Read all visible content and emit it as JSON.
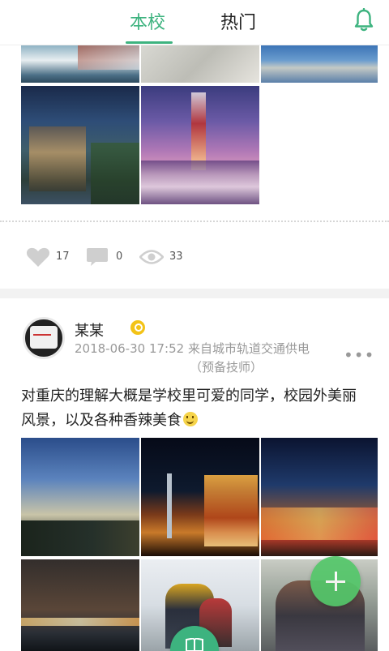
{
  "header": {
    "tabs": [
      {
        "label": "本校",
        "active": true
      },
      {
        "label": "热门",
        "active": false
      }
    ],
    "notification_icon": "bell-icon",
    "accent_color": "#3db37f"
  },
  "post1": {
    "image_count_visible": 5,
    "stats": {
      "likes": "17",
      "comments": "0",
      "views": "33"
    },
    "icons": [
      "heart-icon",
      "comment-icon",
      "eye-icon"
    ]
  },
  "post2": {
    "username": "某某",
    "badge_icon": "verified-badge-icon",
    "timestamp": "2018-06-30 17:52",
    "source_line1": "来自城市轨道交通供电",
    "source_line2": "（预备技师）",
    "more_label": "•••",
    "content_text": "对重庆的理解大概是学校里可爱的同学，校园外美丽风景，以及各种香辣美食",
    "image_count_visible": 6
  },
  "floating": {
    "add_button_icon": "plus-icon",
    "bottom_button_icon": "book-icon",
    "add_color": "#54c76a"
  }
}
